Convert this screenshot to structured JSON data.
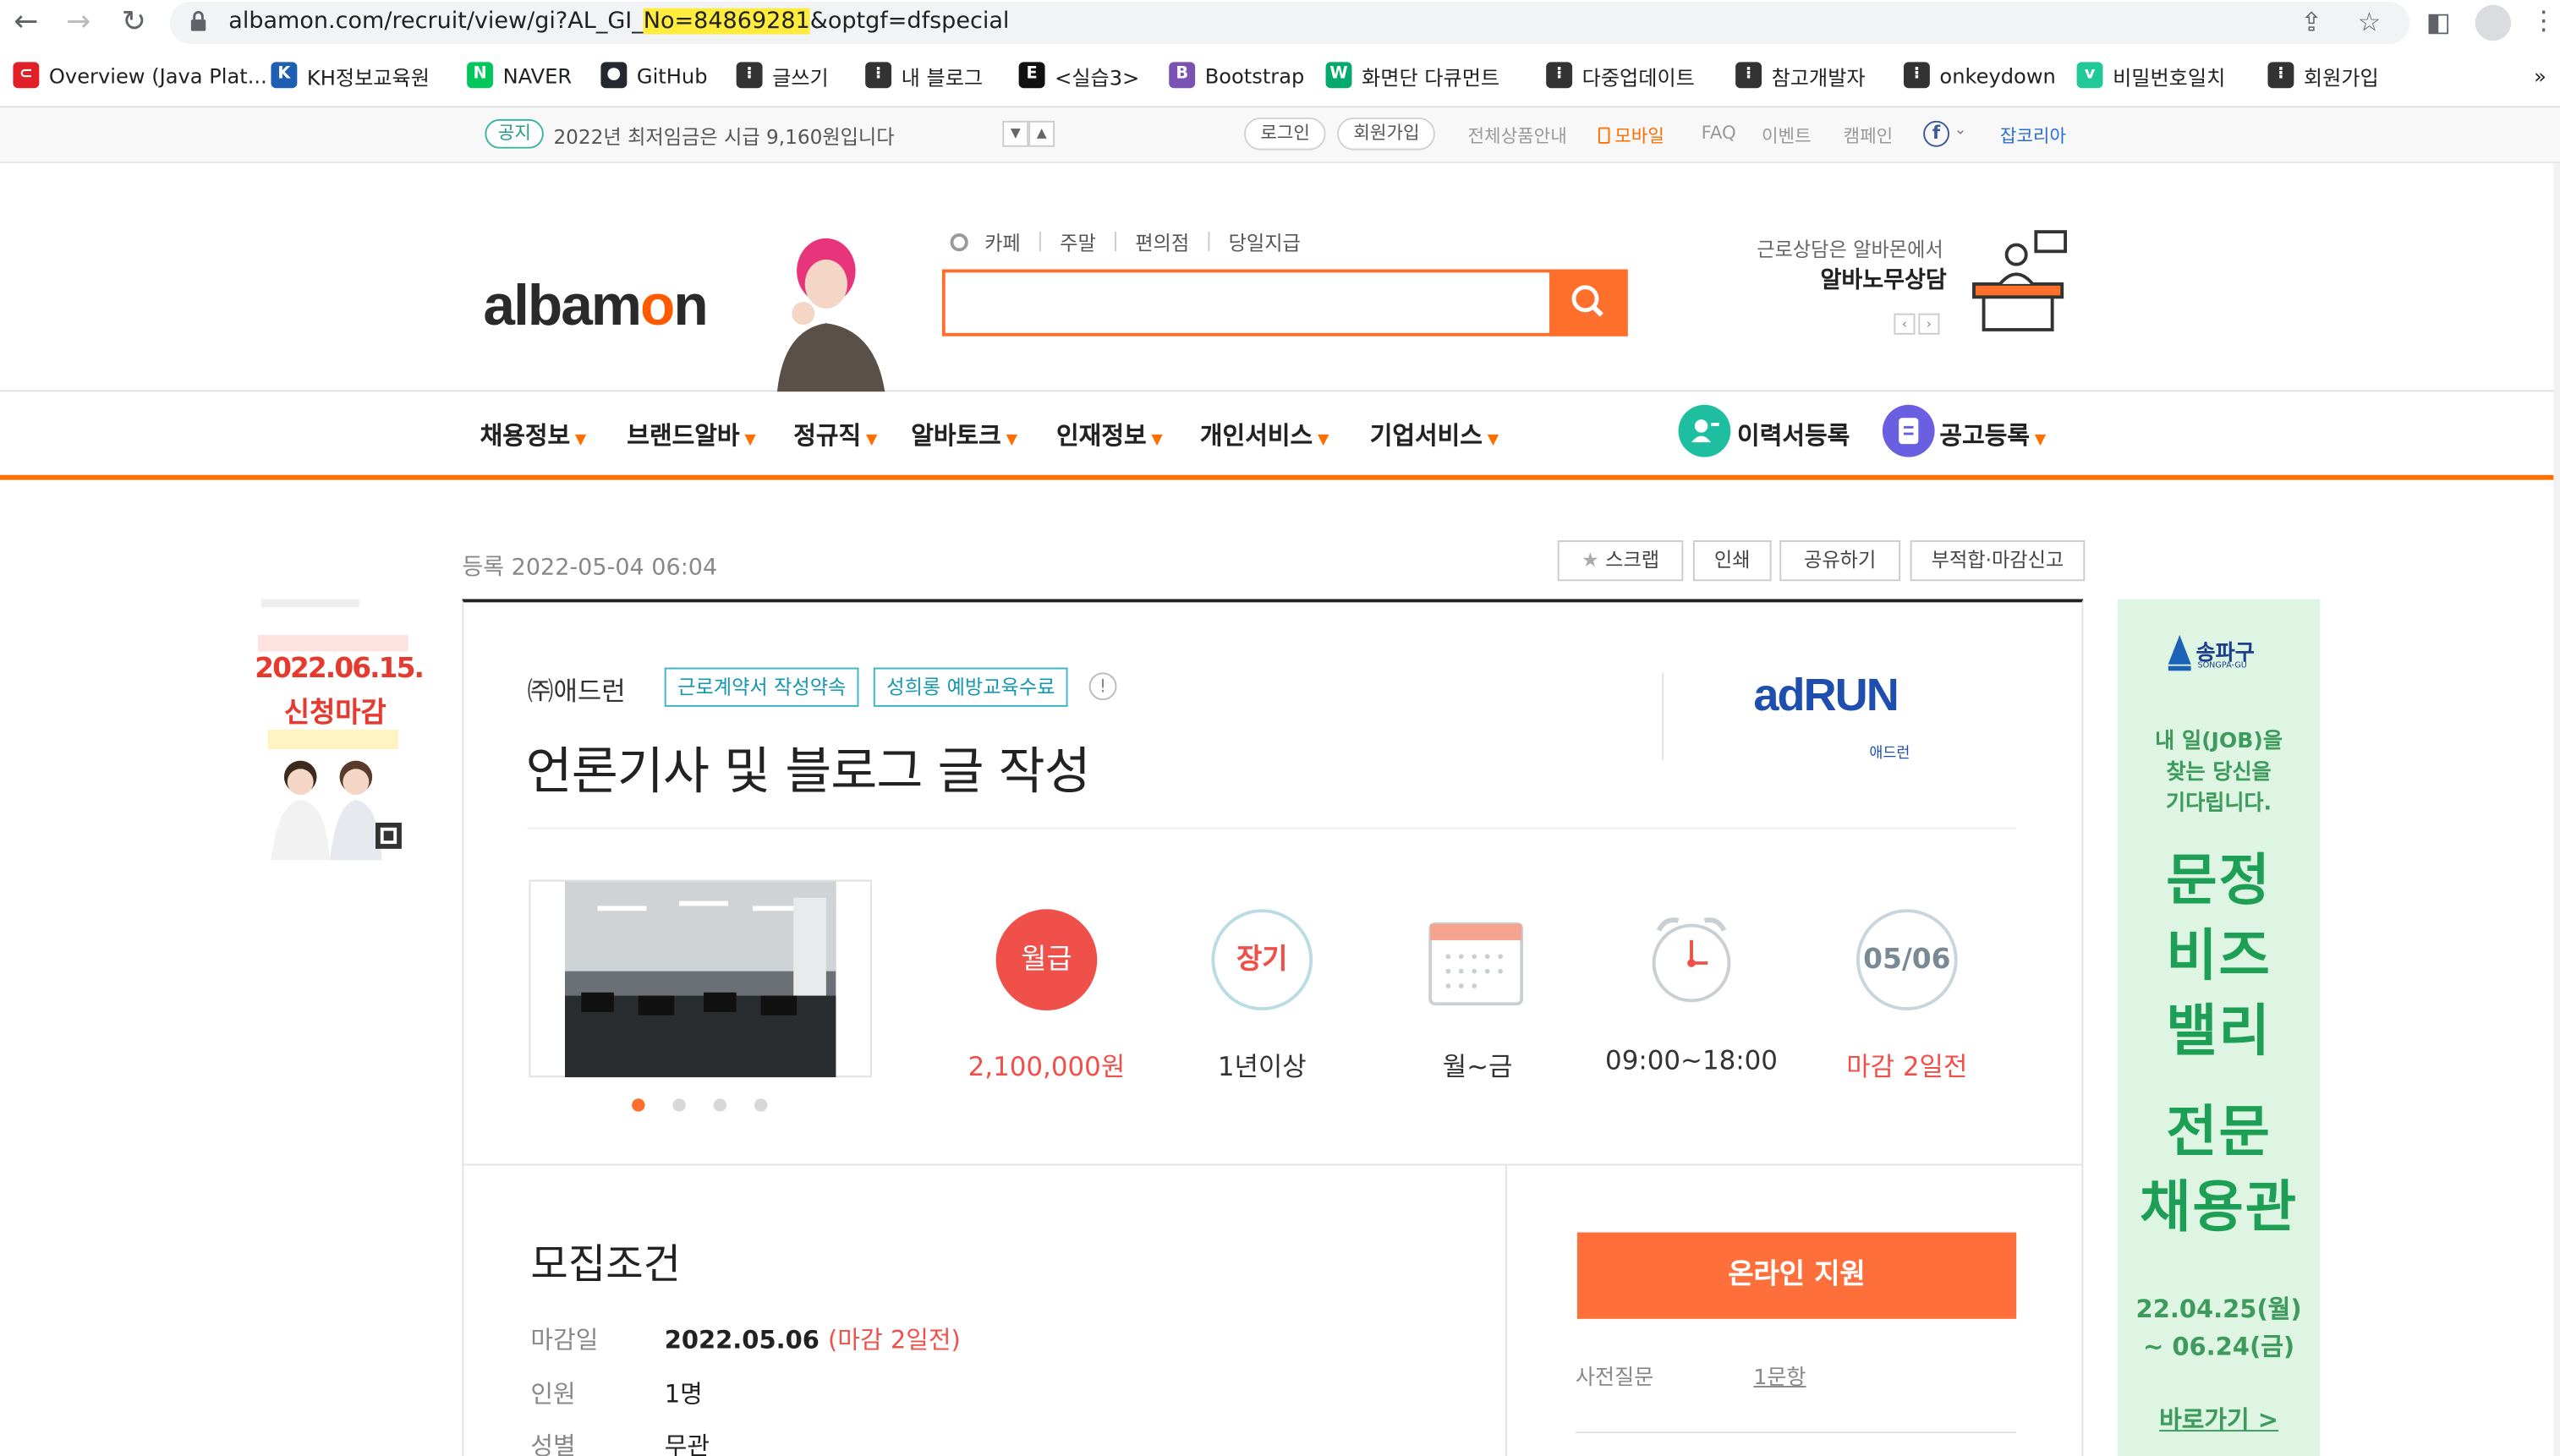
{
  "browser": {
    "url_prefix": "albamon.com/recruit/view/gi?AL_GI_",
    "url_highlight": "No=84869281",
    "url_suffix": "&optgf=dfspecial",
    "bookmarks": [
      {
        "label": "Overview (Java Plat...",
        "icon": "oracle-icon",
        "color": "#e01f26"
      },
      {
        "label": "KH정보교육원",
        "icon": "kh-icon",
        "color": "#1f5fb3"
      },
      {
        "label": "NAVER",
        "icon": "naver-icon",
        "color": "#03c75a"
      },
      {
        "label": "GitHub",
        "icon": "github-icon",
        "color": "#24292f"
      },
      {
        "label": "글쓰기",
        "icon": "tistory-icon",
        "color": "#333333"
      },
      {
        "label": "내 블로그",
        "icon": "tistory-icon",
        "color": "#333333"
      },
      {
        "label": "<실습3>",
        "icon": "erd-icon",
        "color": "#111111"
      },
      {
        "label": "Bootstrap",
        "icon": "bootstrap-icon",
        "color": "#7952b3"
      },
      {
        "label": "화면단 다큐먼트",
        "icon": "w3-icon",
        "color": "#04aa6d"
      },
      {
        "label": "다중업데이트",
        "icon": "tistory-icon",
        "color": "#333333"
      },
      {
        "label": "참고개발자",
        "icon": "tistory-icon",
        "color": "#333333"
      },
      {
        "label": "onkeydown",
        "icon": "tistory-icon",
        "color": "#333333"
      },
      {
        "label": "비밀번호일치",
        "icon": "velog-icon",
        "color": "#20c997"
      },
      {
        "label": "회원가입",
        "icon": "tistory-icon",
        "color": "#333333"
      }
    ],
    "more": "»"
  },
  "notice": {
    "badge": "공지",
    "text": "2022년 최저임금은 시급 9,160원입니다",
    "login": "로그인",
    "signup": "회원가입",
    "utils": [
      "전체상품안내",
      "모바일",
      "FAQ",
      "이벤트",
      "캠페인"
    ],
    "jobkorea": "잡코리아"
  },
  "header": {
    "logo_a": "albam",
    "logo_o": "o",
    "logo_n": "n",
    "search_tabs": [
      "카페",
      "주말",
      "편의점",
      "당일지급"
    ],
    "counsel_line1": "근로상담은 알바몬에서",
    "counsel_line2": "알바노무상담"
  },
  "gnb": {
    "items": [
      "채용정보",
      "브랜드알바",
      "정규직",
      "알바토크",
      "인재정보",
      "개인서비스",
      "기업서비스"
    ],
    "resume": "이력서등록",
    "post": "공고등록"
  },
  "post": {
    "registered": "등록 2022-05-04 06:04",
    "actions": [
      "스크랩",
      "인쇄",
      "공유하기",
      "부적합·마감신고"
    ],
    "company": "㈜애드런",
    "tags": [
      "근로계약서 작성약속",
      "성희롱 예방교육수료"
    ],
    "title": "언론기사 및 블로그 글 작성",
    "company_logo_main": "adRUN",
    "company_logo_sub": "애드런",
    "stats": {
      "pay_badge": "월급",
      "pay": "2,100,000원",
      "period_badge": "장기",
      "period": "1년이상",
      "days": "월~금",
      "hours": "09:00~18:00",
      "deadline_badge": "05/06",
      "deadline": "마감 2일전"
    }
  },
  "conditions": {
    "heading": "모집조건",
    "rows": [
      {
        "label": "마감일",
        "value": "2022.05.06",
        "note": "(마감 2일전)"
      },
      {
        "label": "인원",
        "value": "1명",
        "note": ""
      },
      {
        "label": "성별",
        "value": "무관",
        "note": ""
      }
    ]
  },
  "apply": {
    "button": "온라인 지원",
    "question_label": "사전질문",
    "question_link": "1문항"
  },
  "left_ad": {
    "date": "2022.06.15.",
    "text": "신청마감"
  },
  "right_ad": {
    "org": "송파구",
    "org_en": "SONGPA-GU",
    "line1": "내 일(JOB)을",
    "line2": "찾는 당신을",
    "line3": "기다립니다.",
    "big1": "문정",
    "big2": "비즈",
    "big3": "밸리",
    "big4": "전문",
    "big5": "채용관",
    "date1": "22.04.25(월)",
    "date2": "~ 06.24(금)",
    "link": "바로가기 >"
  },
  "colors": {
    "accent": "#ff6f00",
    "pay_red": "#f0504a",
    "teal": "#1497b0"
  }
}
